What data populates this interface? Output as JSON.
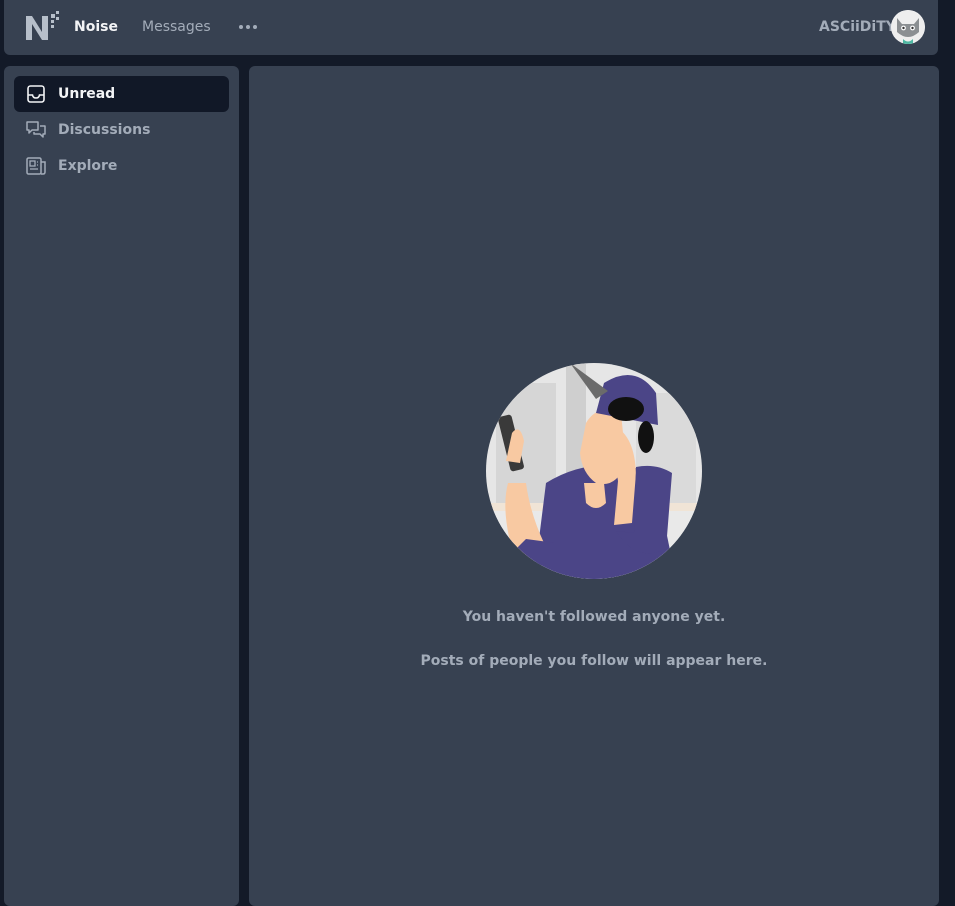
{
  "header": {
    "logo": "noise-logo",
    "nav": [
      {
        "label": "Noise",
        "active": true
      },
      {
        "label": "Messages",
        "active": false
      }
    ],
    "more_icon": "ellipsis-icon",
    "username": "ASCiiDiTY",
    "avatar_icon": "cat-avatar-icon"
  },
  "sidebar": {
    "items": [
      {
        "label": "Unread",
        "icon": "inbox-icon",
        "active": true
      },
      {
        "label": "Discussions",
        "icon": "chat-bubbles-icon",
        "active": false
      },
      {
        "label": "Explore",
        "icon": "newspaper-icon",
        "active": false
      }
    ]
  },
  "empty_state": {
    "illustration": "person-on-phone-illustration",
    "title": "You haven't followed anyone yet.",
    "subtitle": "Posts of people you follow will appear here."
  },
  "colors": {
    "background": "#131a28",
    "panel": "#374151",
    "active_item": "#111827",
    "text_muted": "#a3acb9",
    "text_active": "#f3f4f6"
  }
}
